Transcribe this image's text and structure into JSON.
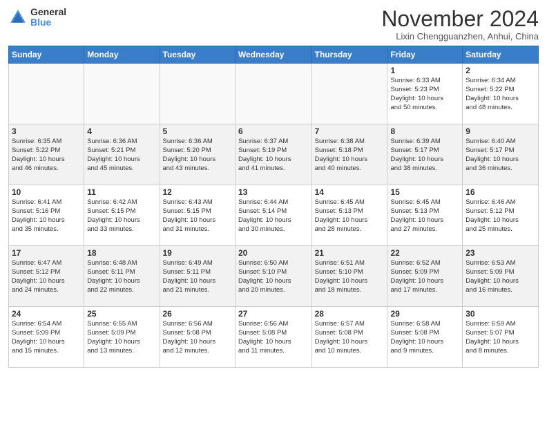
{
  "header": {
    "logo_general": "General",
    "logo_blue": "Blue",
    "month_title": "November 2024",
    "subtitle": "Lixin Chengguanzhen, Anhui, China"
  },
  "days_of_week": [
    "Sunday",
    "Monday",
    "Tuesday",
    "Wednesday",
    "Thursday",
    "Friday",
    "Saturday"
  ],
  "weeks": [
    [
      {
        "day": "",
        "info": ""
      },
      {
        "day": "",
        "info": ""
      },
      {
        "day": "",
        "info": ""
      },
      {
        "day": "",
        "info": ""
      },
      {
        "day": "",
        "info": ""
      },
      {
        "day": "1",
        "info": "Sunrise: 6:33 AM\nSunset: 5:23 PM\nDaylight: 10 hours\nand 50 minutes."
      },
      {
        "day": "2",
        "info": "Sunrise: 6:34 AM\nSunset: 5:22 PM\nDaylight: 10 hours\nand 48 minutes."
      }
    ],
    [
      {
        "day": "3",
        "info": "Sunrise: 6:35 AM\nSunset: 5:22 PM\nDaylight: 10 hours\nand 46 minutes."
      },
      {
        "day": "4",
        "info": "Sunrise: 6:36 AM\nSunset: 5:21 PM\nDaylight: 10 hours\nand 45 minutes."
      },
      {
        "day": "5",
        "info": "Sunrise: 6:36 AM\nSunset: 5:20 PM\nDaylight: 10 hours\nand 43 minutes."
      },
      {
        "day": "6",
        "info": "Sunrise: 6:37 AM\nSunset: 5:19 PM\nDaylight: 10 hours\nand 41 minutes."
      },
      {
        "day": "7",
        "info": "Sunrise: 6:38 AM\nSunset: 5:18 PM\nDaylight: 10 hours\nand 40 minutes."
      },
      {
        "day": "8",
        "info": "Sunrise: 6:39 AM\nSunset: 5:17 PM\nDaylight: 10 hours\nand 38 minutes."
      },
      {
        "day": "9",
        "info": "Sunrise: 6:40 AM\nSunset: 5:17 PM\nDaylight: 10 hours\nand 36 minutes."
      }
    ],
    [
      {
        "day": "10",
        "info": "Sunrise: 6:41 AM\nSunset: 5:16 PM\nDaylight: 10 hours\nand 35 minutes."
      },
      {
        "day": "11",
        "info": "Sunrise: 6:42 AM\nSunset: 5:15 PM\nDaylight: 10 hours\nand 33 minutes."
      },
      {
        "day": "12",
        "info": "Sunrise: 6:43 AM\nSunset: 5:15 PM\nDaylight: 10 hours\nand 31 minutes."
      },
      {
        "day": "13",
        "info": "Sunrise: 6:44 AM\nSunset: 5:14 PM\nDaylight: 10 hours\nand 30 minutes."
      },
      {
        "day": "14",
        "info": "Sunrise: 6:45 AM\nSunset: 5:13 PM\nDaylight: 10 hours\nand 28 minutes."
      },
      {
        "day": "15",
        "info": "Sunrise: 6:45 AM\nSunset: 5:13 PM\nDaylight: 10 hours\nand 27 minutes."
      },
      {
        "day": "16",
        "info": "Sunrise: 6:46 AM\nSunset: 5:12 PM\nDaylight: 10 hours\nand 25 minutes."
      }
    ],
    [
      {
        "day": "17",
        "info": "Sunrise: 6:47 AM\nSunset: 5:12 PM\nDaylight: 10 hours\nand 24 minutes."
      },
      {
        "day": "18",
        "info": "Sunrise: 6:48 AM\nSunset: 5:11 PM\nDaylight: 10 hours\nand 22 minutes."
      },
      {
        "day": "19",
        "info": "Sunrise: 6:49 AM\nSunset: 5:11 PM\nDaylight: 10 hours\nand 21 minutes."
      },
      {
        "day": "20",
        "info": "Sunrise: 6:50 AM\nSunset: 5:10 PM\nDaylight: 10 hours\nand 20 minutes."
      },
      {
        "day": "21",
        "info": "Sunrise: 6:51 AM\nSunset: 5:10 PM\nDaylight: 10 hours\nand 18 minutes."
      },
      {
        "day": "22",
        "info": "Sunrise: 6:52 AM\nSunset: 5:09 PM\nDaylight: 10 hours\nand 17 minutes."
      },
      {
        "day": "23",
        "info": "Sunrise: 6:53 AM\nSunset: 5:09 PM\nDaylight: 10 hours\nand 16 minutes."
      }
    ],
    [
      {
        "day": "24",
        "info": "Sunrise: 6:54 AM\nSunset: 5:09 PM\nDaylight: 10 hours\nand 15 minutes."
      },
      {
        "day": "25",
        "info": "Sunrise: 6:55 AM\nSunset: 5:09 PM\nDaylight: 10 hours\nand 13 minutes."
      },
      {
        "day": "26",
        "info": "Sunrise: 6:56 AM\nSunset: 5:08 PM\nDaylight: 10 hours\nand 12 minutes."
      },
      {
        "day": "27",
        "info": "Sunrise: 6:56 AM\nSunset: 5:08 PM\nDaylight: 10 hours\nand 11 minutes."
      },
      {
        "day": "28",
        "info": "Sunrise: 6:57 AM\nSunset: 5:08 PM\nDaylight: 10 hours\nand 10 minutes."
      },
      {
        "day": "29",
        "info": "Sunrise: 6:58 AM\nSunset: 5:08 PM\nDaylight: 10 hours\nand 9 minutes."
      },
      {
        "day": "30",
        "info": "Sunrise: 6:59 AM\nSunset: 5:07 PM\nDaylight: 10 hours\nand 8 minutes."
      }
    ]
  ]
}
